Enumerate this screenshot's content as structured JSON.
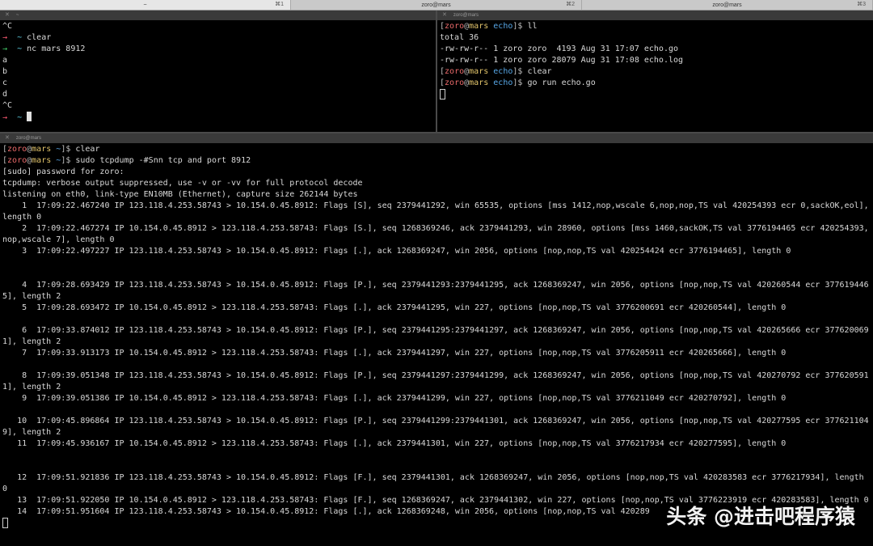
{
  "tabs": [
    {
      "title": "~",
      "shortcut": "⌘1",
      "active": true
    },
    {
      "title": "zoro@mars",
      "shortcut": "⌘2",
      "active": false
    },
    {
      "title": "zoro@mars",
      "shortcut": "⌘3",
      "active": false
    }
  ],
  "panes": {
    "top_left": {
      "header": "~",
      "lines": [
        {
          "t": "^C"
        },
        {
          "p": "→",
          "pc": "red",
          "d": "~",
          "c": "clear"
        },
        {
          "p": "→",
          "pc": "grn",
          "d": "~",
          "c": "nc mars 8912"
        },
        {
          "t": "a"
        },
        {
          "t": "b"
        },
        {
          "t": "c"
        },
        {
          "t": "d"
        },
        {
          "t": "^C"
        },
        {
          "p": "→",
          "pc": "red",
          "d": "~",
          "c": "",
          "cursor": "block"
        }
      ]
    },
    "top_right": {
      "header": "zoro@mars",
      "lines": [
        {
          "u": "zoro",
          "h": "mars",
          "d": "echo",
          "c": "ll"
        },
        {
          "t": "total 36"
        },
        {
          "t": "-rw-rw-r-- 1 zoro zoro  4193 Aug 31 17:07 echo.go"
        },
        {
          "t": "-rw-rw-r-- 1 zoro zoro 28079 Aug 31 17:08 echo.log"
        },
        {
          "u": "zoro",
          "h": "mars",
          "d": "echo",
          "c": "clear"
        },
        {
          "u": "zoro",
          "h": "mars",
          "d": "echo",
          "c": "go run echo.go"
        },
        {
          "t": "",
          "cursor": "hollow"
        }
      ]
    },
    "bottom": {
      "header": "zoro@mars",
      "lines": [
        {
          "u": "zoro",
          "h": "mars",
          "d": "~",
          "c": "clear"
        },
        {
          "u": "zoro",
          "h": "mars",
          "d": "~",
          "c": "sudo tcpdump -#Snn tcp and port 8912"
        },
        {
          "t": "[sudo] password for zoro:"
        },
        {
          "t": "tcpdump: verbose output suppressed, use -v or -vv for full protocol decode"
        },
        {
          "t": "listening on eth0, link-type EN10MB (Ethernet), capture size 262144 bytes"
        },
        {
          "t": "    1  17:09:22.467240 IP 123.118.4.253.58743 > 10.154.0.45.8912: Flags [S], seq 2379441292, win 65535, options [mss 1412,nop,wscale 6,nop,nop,TS val 420254393 ecr 0,sackOK,eol], length 0"
        },
        {
          "t": "    2  17:09:22.467274 IP 10.154.0.45.8912 > 123.118.4.253.58743: Flags [S.], seq 1268369246, ack 2379441293, win 28960, options [mss 1460,sackOK,TS val 3776194465 ecr 420254393,nop,wscale 7], length 0"
        },
        {
          "t": "    3  17:09:22.497227 IP 123.118.4.253.58743 > 10.154.0.45.8912: Flags [.], ack 1268369247, win 2056, options [nop,nop,TS val 420254424 ecr 3776194465], length 0"
        },
        {
          "t": ""
        },
        {
          "t": ""
        },
        {
          "t": "    4  17:09:28.693429 IP 123.118.4.253.58743 > 10.154.0.45.8912: Flags [P.], seq 2379441293:2379441295, ack 1268369247, win 2056, options [nop,nop,TS val 420260544 ecr 3776194465], length 2"
        },
        {
          "t": "    5  17:09:28.693472 IP 10.154.0.45.8912 > 123.118.4.253.58743: Flags [.], ack 2379441295, win 227, options [nop,nop,TS val 3776200691 ecr 420260544], length 0"
        },
        {
          "t": ""
        },
        {
          "t": "    6  17:09:33.874012 IP 123.118.4.253.58743 > 10.154.0.45.8912: Flags [P.], seq 2379441295:2379441297, ack 1268369247, win 2056, options [nop,nop,TS val 420265666 ecr 3776200691], length 2"
        },
        {
          "t": "    7  17:09:33.913173 IP 10.154.0.45.8912 > 123.118.4.253.58743: Flags [.], ack 2379441297, win 227, options [nop,nop,TS val 3776205911 ecr 420265666], length 0"
        },
        {
          "t": ""
        },
        {
          "t": "    8  17:09:39.051348 IP 123.118.4.253.58743 > 10.154.0.45.8912: Flags [P.], seq 2379441297:2379441299, ack 1268369247, win 2056, options [nop,nop,TS val 420270792 ecr 3776205911], length 2"
        },
        {
          "t": "    9  17:09:39.051386 IP 10.154.0.45.8912 > 123.118.4.253.58743: Flags [.], ack 2379441299, win 227, options [nop,nop,TS val 3776211049 ecr 420270792], length 0"
        },
        {
          "t": ""
        },
        {
          "t": "   10  17:09:45.896864 IP 123.118.4.253.58743 > 10.154.0.45.8912: Flags [P.], seq 2379441299:2379441301, ack 1268369247, win 2056, options [nop,nop,TS val 420277595 ecr 3776211049], length 2"
        },
        {
          "t": "   11  17:09:45.936167 IP 10.154.0.45.8912 > 123.118.4.253.58743: Flags [.], ack 2379441301, win 227, options [nop,nop,TS val 3776217934 ecr 420277595], length 0"
        },
        {
          "t": ""
        },
        {
          "t": ""
        },
        {
          "t": "   12  17:09:51.921836 IP 123.118.4.253.58743 > 10.154.0.45.8912: Flags [F.], seq 2379441301, ack 1268369247, win 2056, options [nop,nop,TS val 420283583 ecr 3776217934], length 0"
        },
        {
          "t": "   13  17:09:51.922050 IP 10.154.0.45.8912 > 123.118.4.253.58743: Flags [F.], seq 1268369247, ack 2379441302, win 227, options [nop,nop,TS val 3776223919 ecr 420283583], length 0"
        },
        {
          "t": "   14  17:09:51.951604 IP 123.118.4.253.58743 > 10.154.0.45.8912: Flags [.], ack 1268369248, win 2056, options [nop,nop,TS val 420289"
        },
        {
          "t": "",
          "cursor": "hollow"
        }
      ]
    }
  },
  "watermark": "头条 @进击吧程序猿",
  "colors": {
    "user": "#ea6a6a",
    "host": "#e1c36a",
    "dir": "#58a8e8",
    "arrow_red": "#ff5b73",
    "arrow_green": "#44d16b",
    "tilde": "#5fd3e8"
  }
}
